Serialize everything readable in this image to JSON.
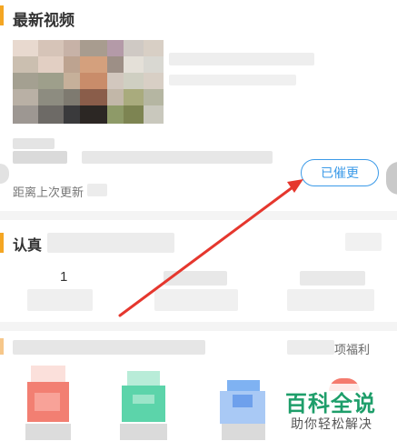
{
  "section_latest": {
    "title": "最新视频"
  },
  "video_card": {
    "update_note": "距离上次更新",
    "remind_button": "已催更"
  },
  "section_follow": {
    "title": "认真"
  },
  "stats": {
    "first_value": "1"
  },
  "welfare": {
    "label": "项福利"
  },
  "watermark": {
    "title": "百科全说",
    "subtitle": "助你轻松解决"
  },
  "colors": {
    "accent_orange": "#f4a623",
    "button_blue": "#3b9ae8",
    "arrow_red": "#e5372e",
    "watermark_green": "#1e9e6a"
  }
}
